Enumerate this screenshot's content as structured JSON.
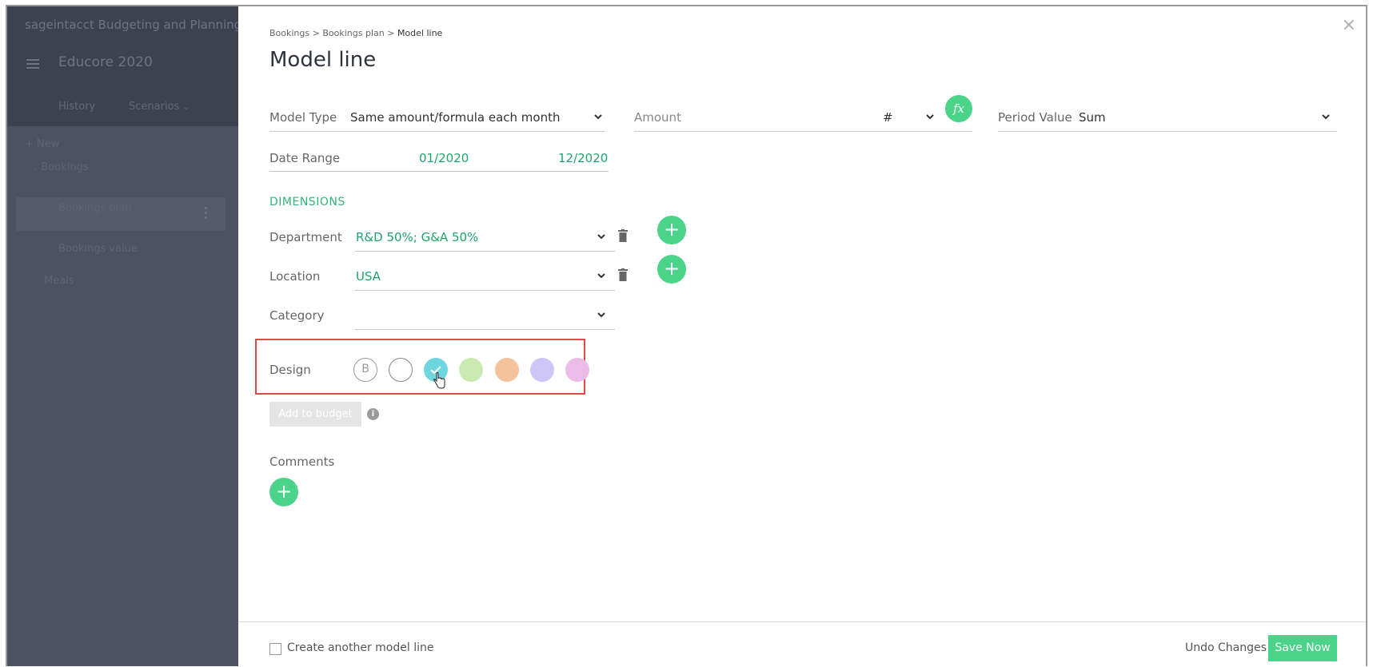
{
  "sidebar": {
    "brand": "sageintacct Budgeting and Planning",
    "title": "Educore 2020",
    "tabs": [
      "History",
      "Scenarios"
    ],
    "new_label": "+ New",
    "tree": {
      "group": "Bookings",
      "items": [
        "Bookings plan",
        "Bookings value"
      ],
      "other": "Meals"
    }
  },
  "breadcrumb": {
    "part1": "Bookings",
    "sep": ">",
    "part2": "Bookings plan",
    "current": "Model line"
  },
  "page_title": "Model line",
  "model": {
    "type_label": "Model Type",
    "type_value": "Same amount/formula each month",
    "amount_label": "Amount",
    "amount_unit": "#",
    "fx_label": "fx",
    "period_label": "Period Value",
    "period_value": "Sum",
    "date_label": "Date Range",
    "date_start": "01/2020",
    "date_end": "12/2020"
  },
  "dimensions": {
    "heading": "DIMENSIONS",
    "department_label": "Department",
    "department_value": "R&D 50%; G&A 50%",
    "location_label": "Location",
    "location_value": "USA",
    "category_label": "Category",
    "category_value": ""
  },
  "design": {
    "label": "Design",
    "bold_glyph": "B",
    "colors": [
      "#6fd6e0",
      "#c9eab0",
      "#f5c29e",
      "#cdc6f7",
      "#ecbce8"
    ],
    "selected_index": 0
  },
  "add_budget_label": "Add to budget",
  "comments_label": "Comments",
  "footer": {
    "create_another_label": "Create another model line",
    "undo_label": "Undo Changes",
    "save_label": "Save Now"
  },
  "colors": {
    "accent": "#4cd38a",
    "accent_text": "#1fa36f",
    "highlight_border": "#e24a4a"
  }
}
